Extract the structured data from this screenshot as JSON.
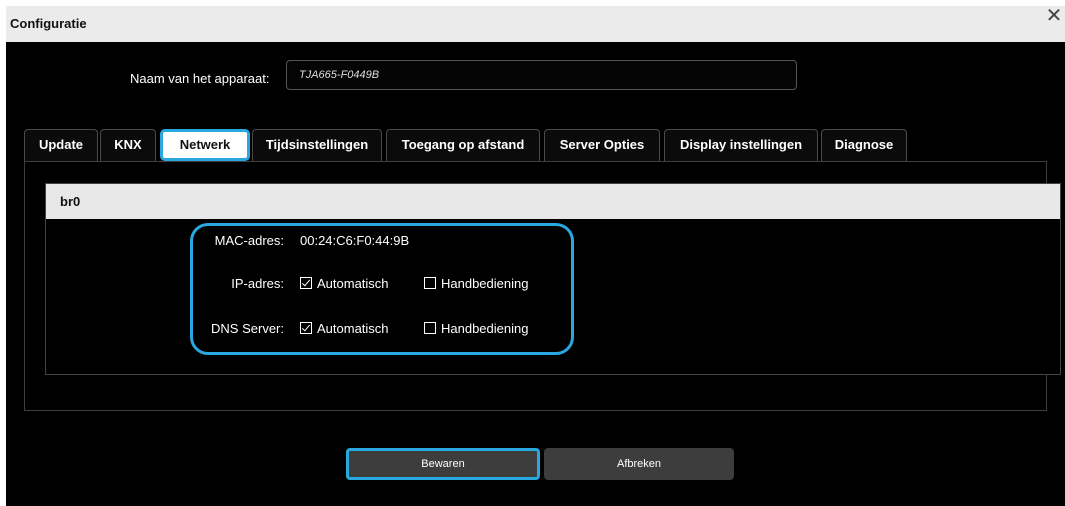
{
  "window": {
    "title": "Configuratie",
    "close_glyph": "✕"
  },
  "device": {
    "name_label": "Naam van het apparaat:",
    "name_value": "TJA665-F0449B"
  },
  "tabs": [
    {
      "label": "Update"
    },
    {
      "label": "KNX"
    },
    {
      "label": "Netwerk",
      "active": true
    },
    {
      "label": "Tijdsinstellingen"
    },
    {
      "label": "Toegang op afstand"
    },
    {
      "label": "Server Opties"
    },
    {
      "label": "Display instellingen"
    },
    {
      "label": "Diagnose"
    }
  ],
  "network": {
    "section_title": "br0",
    "mac_label": "MAC-adres:",
    "mac_value": "00:24:C6:F0:44:9B",
    "ip_label": "IP-adres:",
    "ip_auto": "Automatisch",
    "ip_manual": "Handbediening",
    "dns_label": "DNS Server:",
    "dns_auto": "Automatisch",
    "dns_manual": "Handbediening"
  },
  "buttons": {
    "save": "Bewaren",
    "cancel": "Afbreken"
  },
  "colors": {
    "highlight": "#29a8e0",
    "dialog_bg": "#000000"
  }
}
